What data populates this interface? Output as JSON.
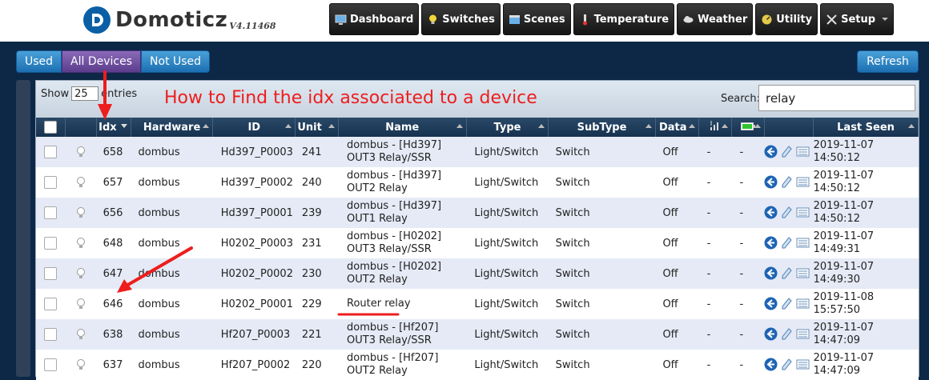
{
  "header": {
    "logo_text": "Domoticz",
    "version": "V4.11468",
    "nav": [
      {
        "label": "Dashboard",
        "icon": "monitor-icon"
      },
      {
        "label": "Switches",
        "icon": "bulb-icon"
      },
      {
        "label": "Scenes",
        "icon": "clapper-icon"
      },
      {
        "label": "Temperature",
        "icon": "thermometer-icon"
      },
      {
        "label": "Weather",
        "icon": "cloud-icon"
      },
      {
        "label": "Utility",
        "icon": "gauge-icon"
      },
      {
        "label": "Setup",
        "icon": "tools-icon"
      }
    ]
  },
  "filters": {
    "used": "Used",
    "all": "All Devices",
    "not_used": "Not Used"
  },
  "refresh_label": "Refresh",
  "table_controls": {
    "show_label": "Show",
    "page_size": "25",
    "entries_label": "entries",
    "search_label": "Search:",
    "search_value": "relay"
  },
  "annotation": "How to Find the idx associated to a device",
  "columns": [
    "Idx",
    "Hardware",
    "ID",
    "Unit",
    "Name",
    "Type",
    "SubType",
    "Data",
    "Last Seen"
  ],
  "rows": [
    {
      "idx": "658",
      "hardware": "dombus",
      "id": "Hd397_P0003",
      "unit": "241",
      "name1": "dombus - [Hd397]",
      "name2": "OUT3 Relay/SSR",
      "type": "Light/Switch",
      "subtype": "Switch",
      "data": "Off",
      "signal": "-",
      "battery": "-",
      "date": "2019-11-07",
      "time": "14:50:12"
    },
    {
      "idx": "657",
      "hardware": "dombus",
      "id": "Hd397_P0002",
      "unit": "240",
      "name1": "dombus - [Hd397]",
      "name2": "OUT2 Relay",
      "type": "Light/Switch",
      "subtype": "Switch",
      "data": "Off",
      "signal": "-",
      "battery": "-",
      "date": "2019-11-07",
      "time": "14:50:12"
    },
    {
      "idx": "656",
      "hardware": "dombus",
      "id": "Hd397_P0001",
      "unit": "239",
      "name1": "dombus - [Hd397]",
      "name2": "OUT1 Relay",
      "type": "Light/Switch",
      "subtype": "Switch",
      "data": "Off",
      "signal": "-",
      "battery": "-",
      "date": "2019-11-07",
      "time": "14:50:12"
    },
    {
      "idx": "648",
      "hardware": "dombus",
      "id": "H0202_P0003",
      "unit": "231",
      "name1": "dombus - [H0202]",
      "name2": "OUT3 Relay/SSR",
      "type": "Light/Switch",
      "subtype": "Switch",
      "data": "Off",
      "signal": "-",
      "battery": "-",
      "date": "2019-11-07",
      "time": "14:49:31"
    },
    {
      "idx": "647",
      "hardware": "dombus",
      "id": "H0202_P0002",
      "unit": "230",
      "name1": "dombus - [H0202]",
      "name2": "OUT2 Relay",
      "type": "Light/Switch",
      "subtype": "Switch",
      "data": "Off",
      "signal": "-",
      "battery": "-",
      "date": "2019-11-07",
      "time": "14:49:30"
    },
    {
      "idx": "646",
      "hardware": "dombus",
      "id": "H0202_P0001",
      "unit": "229",
      "name1": "Router relay",
      "name2": "",
      "type": "Light/Switch",
      "subtype": "Switch",
      "data": "Off",
      "signal": "-",
      "battery": "-",
      "date": "2019-11-08",
      "time": "15:57:50"
    },
    {
      "idx": "638",
      "hardware": "dombus",
      "id": "Hf207_P0003",
      "unit": "221",
      "name1": "dombus - [Hf207]",
      "name2": "OUT3 Relay/SSR",
      "type": "Light/Switch",
      "subtype": "Switch",
      "data": "Off",
      "signal": "-",
      "battery": "-",
      "date": "2019-11-07",
      "time": "14:47:09"
    },
    {
      "idx": "637",
      "hardware": "dombus",
      "id": "Hf207_P0002",
      "unit": "220",
      "name1": "dombus - [Hf207]",
      "name2": "OUT2 Relay",
      "type": "Light/Switch",
      "subtype": "Switch",
      "data": "Off",
      "signal": "-",
      "battery": "-",
      "date": "2019-11-07",
      "time": "14:47:09"
    }
  ],
  "colors": {
    "accent": "#1c70b2",
    "active_filter": "#5b3d8d",
    "annotation": "#ee1d1d",
    "header_bg": "#16324f"
  }
}
